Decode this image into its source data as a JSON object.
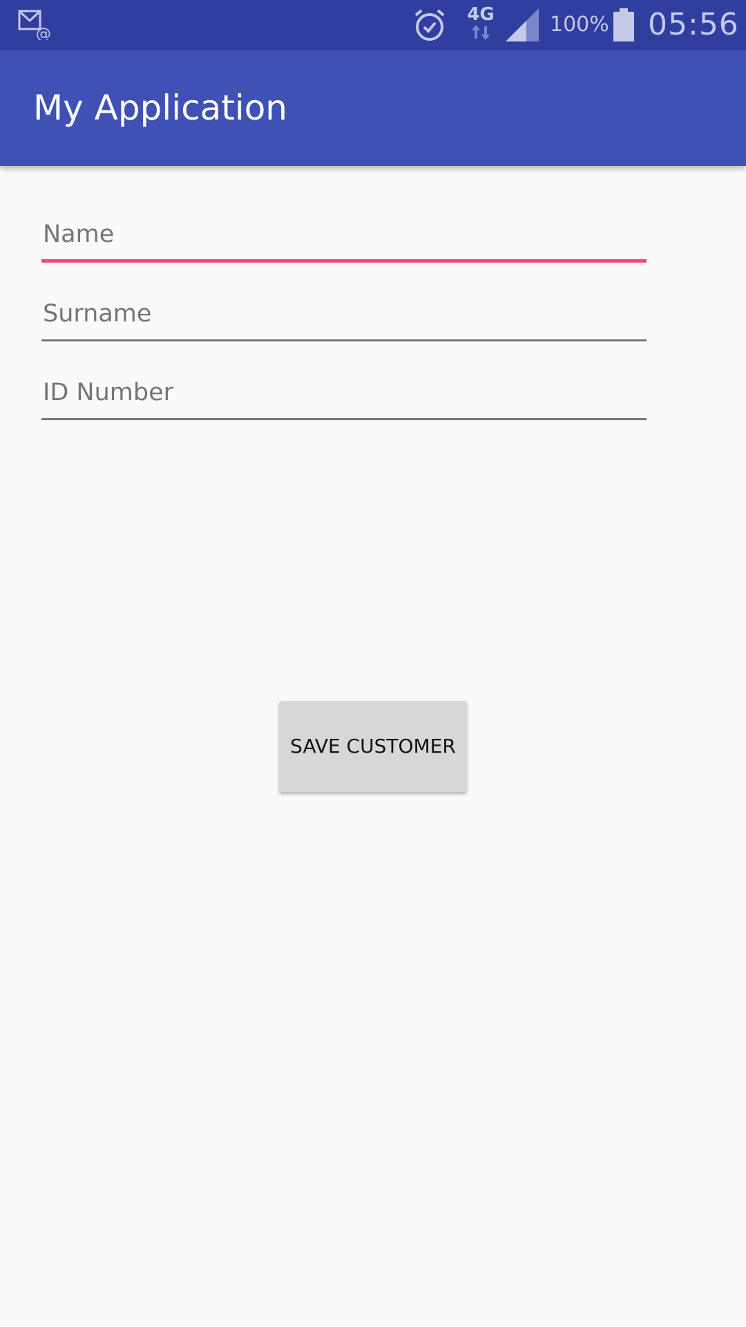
{
  "status_bar": {
    "left_icon": "email-notification-icon",
    "alarm_icon": "alarm-icon",
    "network_type": "4G",
    "signal_icon": "signal-icon",
    "battery_percent": "100%",
    "battery_icon": "battery-icon",
    "time": "05:56"
  },
  "app_bar": {
    "title": "My Application"
  },
  "form": {
    "name_placeholder": "Name",
    "surname_placeholder": "Surname",
    "id_number_placeholder": "ID Number"
  },
  "actions": {
    "save_label": "SAVE CUSTOMER"
  },
  "colors": {
    "status_bar": "#303f9f",
    "app_bar": "#3f51b5",
    "accent": "#ff4081",
    "background": "#fafafa"
  }
}
